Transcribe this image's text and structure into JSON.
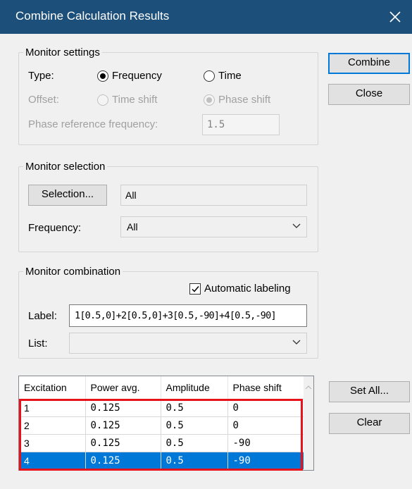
{
  "window": {
    "title": "Combine Calculation Results",
    "close_icon": "close-icon"
  },
  "buttons": {
    "combine": "Combine",
    "close": "Close",
    "set_all": "Set All...",
    "clear": "Clear"
  },
  "monitor_settings": {
    "legend": "Monitor settings",
    "type_label": "Type:",
    "frequency_label": "Frequency",
    "time_label": "Time",
    "type_selected": "Frequency",
    "offset_label": "Offset:",
    "time_shift_label": "Time shift",
    "phase_shift_label": "Phase shift",
    "offset_selected": "Phase shift",
    "phase_ref_label": "Phase reference frequency:",
    "phase_ref_value": "1.5"
  },
  "monitor_selection": {
    "legend": "Monitor selection",
    "selection_button": "Selection...",
    "selection_value": "All",
    "frequency_label": "Frequency:",
    "frequency_value": "All"
  },
  "monitor_combination": {
    "legend": "Monitor combination",
    "auto_label": "Automatic labeling",
    "auto_checked": true,
    "label_label": "Label:",
    "label_value": "1[0.5,0]+2[0.5,0]+3[0.5,-90]+4[0.5,-90]",
    "list_label": "List:",
    "list_value": ""
  },
  "table": {
    "columns": [
      "Excitation",
      "Power avg.",
      "Amplitude",
      "Phase shift"
    ],
    "rows": [
      [
        "1",
        "0.125",
        "0.5",
        "0"
      ],
      [
        "2",
        "0.125",
        "0.5",
        "0"
      ],
      [
        "3",
        "0.125",
        "0.5",
        "-90"
      ],
      [
        "4",
        "0.125",
        "0.5",
        "-90"
      ]
    ],
    "selected_row": 3,
    "highlight_color": "#e8121b",
    "selection_color": "#0078d7"
  },
  "colors": {
    "titlebar": "#1c4f7a",
    "accent": "#0078d7"
  }
}
